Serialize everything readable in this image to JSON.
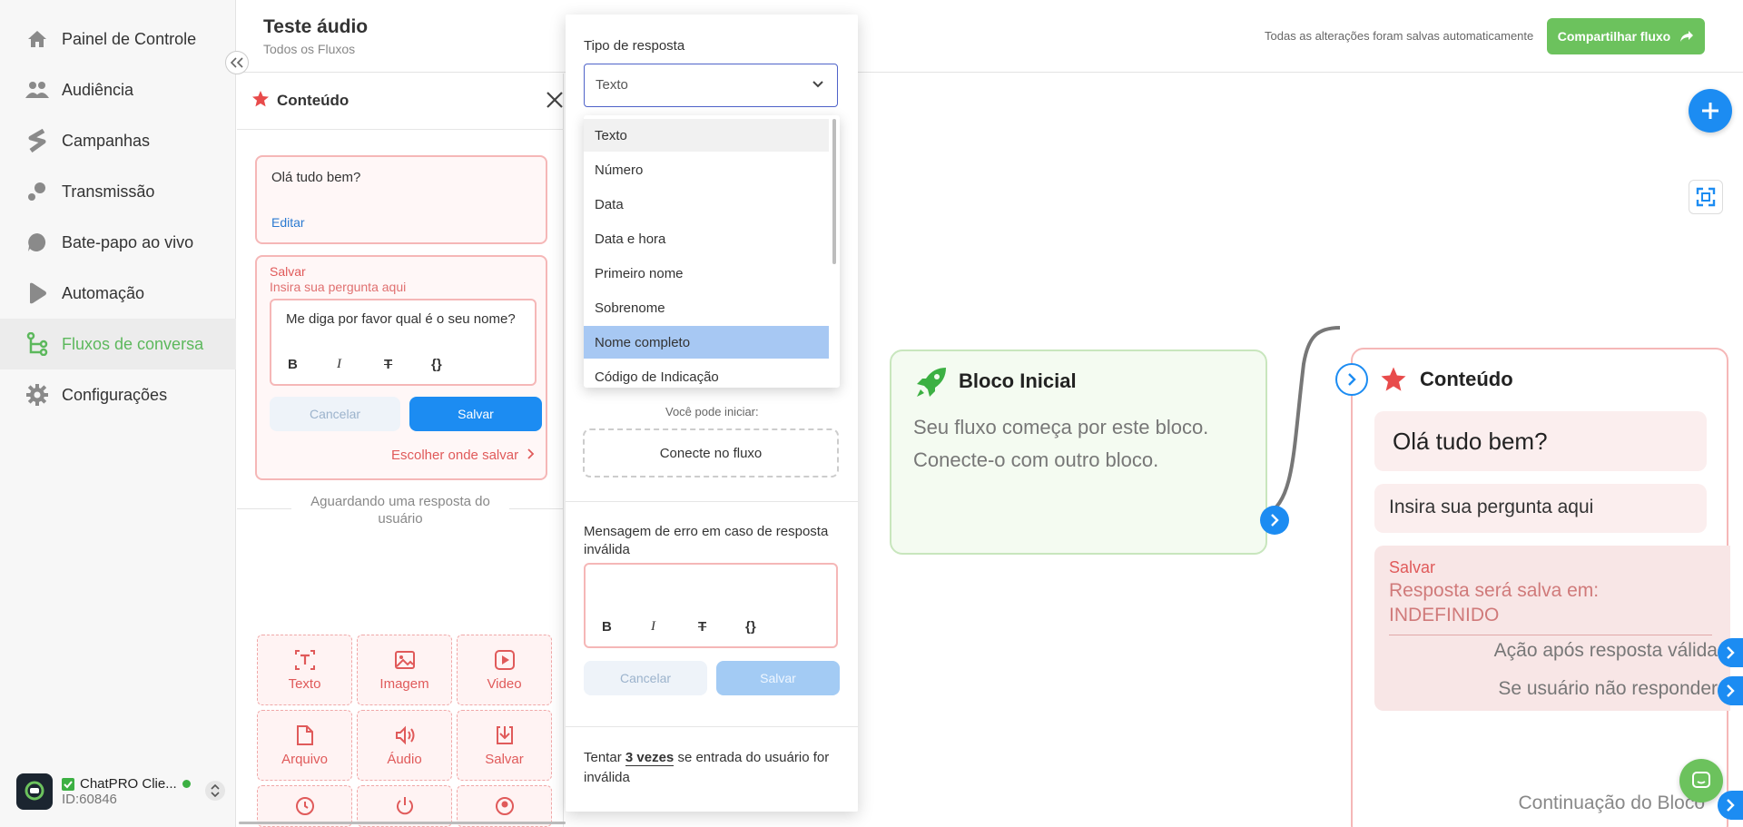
{
  "nav": {
    "items": [
      {
        "label": "Painel de Controle",
        "icon": "home-icon"
      },
      {
        "label": "Audiência",
        "icon": "users-icon"
      },
      {
        "label": "Campanhas",
        "icon": "campaign-icon"
      },
      {
        "label": "Transmissão",
        "icon": "broadcast-icon"
      },
      {
        "label": "Bate-papo ao vivo",
        "icon": "chat-bubble-icon"
      },
      {
        "label": "Automação",
        "icon": "play-icon"
      },
      {
        "label": "Fluxos de conversa",
        "icon": "flow-icon"
      },
      {
        "label": "Configurações",
        "icon": "gear-icon"
      }
    ],
    "active_index": 6,
    "active_color": "#5cb85c"
  },
  "account": {
    "name": "ChatPRO Clie...",
    "id": "ID:60846"
  },
  "header": {
    "title": "Teste áudio",
    "breadcrumb": "Todos os Fluxos",
    "saved_msg": "Todas as alterações foram salvas automaticamente",
    "share_label": "Compartilhar fluxo"
  },
  "panel": {
    "title": "Conteúdo",
    "message": "Olá tudo bem?",
    "edit_label": "Editar",
    "save_label": "Salvar",
    "question_placeholder": "Insira sua pergunta aqui",
    "question_text": "Me diga por favor qual é o seu nome?",
    "fmt": {
      "bold": "B",
      "italic": "I",
      "strike": "T",
      "var": "{}"
    },
    "cancel_label": "Cancelar",
    "save_button_label": "Salvar",
    "choose_save": "Escolher onde salvar",
    "waiting": "Aguardando uma resposta do usuário",
    "tools": [
      {
        "label": "Texto",
        "icon": "text-icon"
      },
      {
        "label": "Imagem",
        "icon": "image-icon"
      },
      {
        "label": "Video",
        "icon": "video-icon"
      },
      {
        "label": "Arquivo",
        "icon": "file-icon"
      },
      {
        "label": "Áudio",
        "icon": "audio-icon"
      },
      {
        "label": "Salvar",
        "icon": "download-icon"
      }
    ]
  },
  "modal": {
    "response_type_label": "Tipo de resposta",
    "response_type_value": "Texto",
    "options": [
      "Texto",
      "Número",
      "Data",
      "Data e hora",
      "Primeiro nome",
      "Sobrenome",
      "Nome completo",
      "Código de Indicação"
    ],
    "hover_index": 0,
    "selected_index": 6,
    "can_start": "Você pode iniciar:",
    "connect_label": "Conecte no fluxo",
    "error_label": "Mensagem de erro em caso de resposta inválida",
    "cancel_label": "Cancelar",
    "save_label": "Salvar",
    "retry_prefix": "Tentar",
    "retry_count": "3 vezes",
    "retry_suffix": "se entrada do usuário for inválida"
  },
  "canvas": {
    "start_block": {
      "title": "Bloco Inicial",
      "desc": "Seu fluxo começa por este bloco. Conecte-o com outro bloco."
    },
    "content_block": {
      "title": "Conteúdo",
      "message": "Olá tudo bem?",
      "question": "Insira sua pergunta aqui",
      "save_label": "Salvar",
      "save_text": "Resposta será salva em: INDEFINIDO",
      "valid_action": "Ação após resposta válida",
      "no_reply": "Se usuário não responder",
      "continuation": "Continuação do Bloco"
    }
  }
}
